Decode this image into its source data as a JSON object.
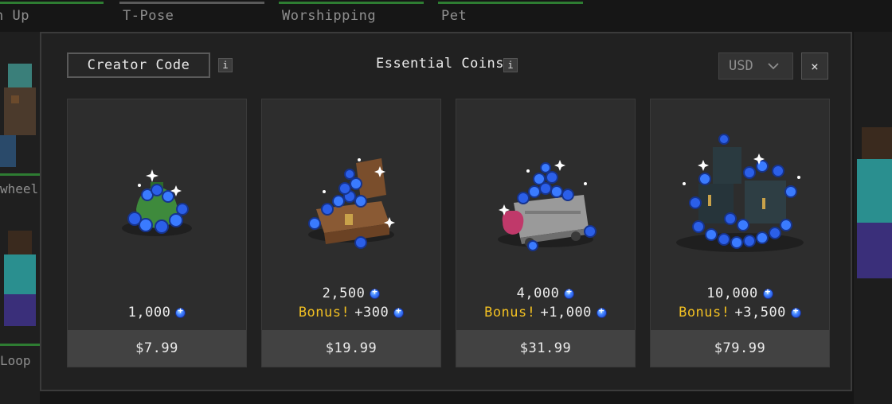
{
  "background": {
    "tabs": [
      {
        "label": "n Up"
      },
      {
        "label": "T-Pose"
      },
      {
        "label": "Worshipping"
      },
      {
        "label": "Pet"
      }
    ],
    "side_labels": [
      "wheel",
      "Loop"
    ]
  },
  "header": {
    "creator_code_label": "Creator Code",
    "info_label": "i",
    "title": "Essential Coins",
    "currency": "USD",
    "close_label": "×"
  },
  "bonus_word": "Bonus!",
  "packs": [
    {
      "coins": "1,000",
      "bonus": "",
      "price": "$7.99",
      "art": "coin-bag"
    },
    {
      "coins": "2,500",
      "bonus": "+300",
      "price": "$19.99",
      "art": "treasure-chest"
    },
    {
      "coins": "4,000",
      "bonus": "+1,000",
      "price": "$31.99",
      "art": "minecart"
    },
    {
      "coins": "10,000",
      "bonus": "+3,500",
      "price": "$79.99",
      "art": "chest-pile"
    }
  ],
  "colors": {
    "accent_green": "#2e7d32",
    "bonus_gold": "#f2c022",
    "coin_blue": "#3a7bff"
  }
}
